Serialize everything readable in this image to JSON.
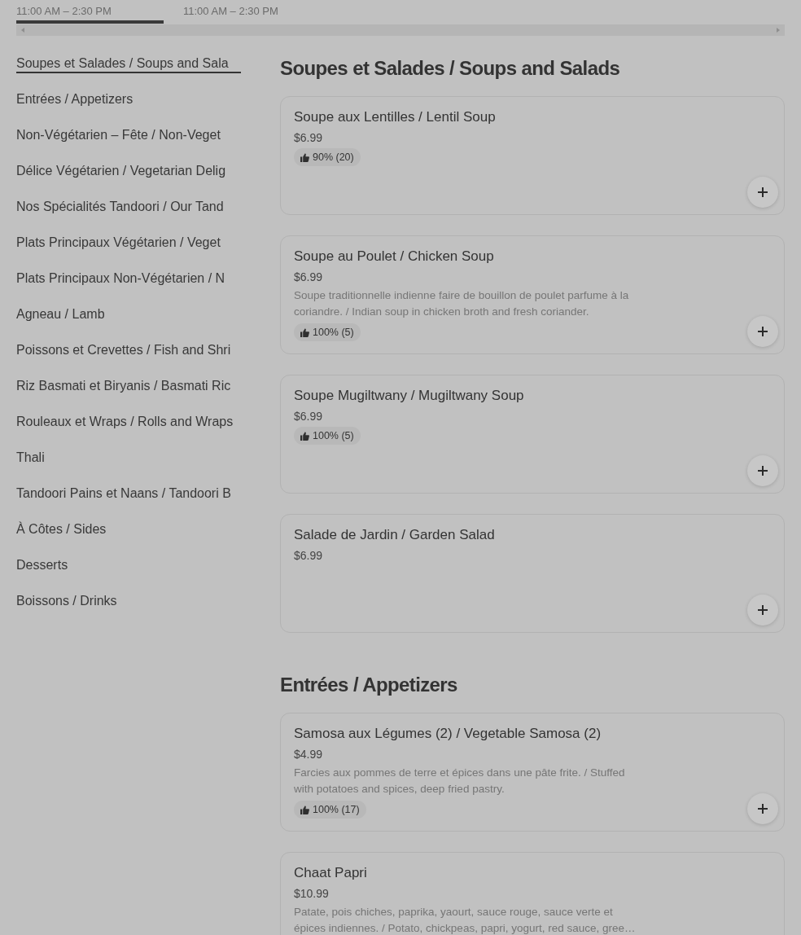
{
  "menu_tabs": [
    {
      "label": "11:00 AM – 2:30 PM",
      "selected": true
    },
    {
      "label": "11:00 AM – 2:30 PM",
      "selected": false
    }
  ],
  "categories": [
    {
      "label": "Soupes et Salades / Soups and Sala",
      "selected": true
    },
    {
      "label": "Entrées / Appetizers",
      "selected": false
    },
    {
      "label": "Non-Végétarien – Fête / Non-Veget",
      "selected": false
    },
    {
      "label": "Délice Végétarien / Vegetarian Delig",
      "selected": false
    },
    {
      "label": "Nos Spécialités Tandoori / Our Tand",
      "selected": false
    },
    {
      "label": "Plats Principaux Végétarien / Veget",
      "selected": false
    },
    {
      "label": "Plats Principaux Non-Végétarien / N",
      "selected": false
    },
    {
      "label": "Agneau / Lamb",
      "selected": false
    },
    {
      "label": "Poissons et Crevettes / Fish and Shri",
      "selected": false
    },
    {
      "label": "Riz Basmati et Biryanis / Basmati Ric",
      "selected": false
    },
    {
      "label": "Rouleaux et Wraps / Rolls and Wraps",
      "selected": false
    },
    {
      "label": "Thali",
      "selected": false
    },
    {
      "label": "Tandoori Pains et Naans / Tandoori B",
      "selected": false
    },
    {
      "label": "À Côtes / Sides",
      "selected": false
    },
    {
      "label": "Desserts",
      "selected": false
    },
    {
      "label": "Boissons / Drinks",
      "selected": false
    }
  ],
  "sections": [
    {
      "title": "Soupes et Salades / Soups and Salads",
      "items": [
        {
          "name": "Soupe aux Lentilles / Lentil Soup",
          "price": "$6.99",
          "rating": "90% (20)",
          "add_button": true
        },
        {
          "name": "Soupe au Poulet / Chicken Soup",
          "price": "$6.99",
          "description": "Soupe traditionnelle indienne faire de bouillon de poulet parfume à la coriandre. / Indian soup in chicken broth and fresh coriander.",
          "rating": "100% (5)",
          "add_button": true
        },
        {
          "name": "Soupe Mugiltwany / Mugiltwany Soup",
          "price": "$6.99",
          "rating": "100% (5)",
          "add_button": true
        },
        {
          "name": "Salade de Jardin / Garden Salad",
          "price": "$6.99",
          "add_button": true
        }
      ]
    },
    {
      "title": "Entrées / Appetizers",
      "items": [
        {
          "name": "Samosa aux Légumes (2) / Vegetable Samosa (2)",
          "price": "$4.99",
          "description": "Farcies aux pommes de terre et épices dans une pâte frite. / Stuffed with potatoes and spices, deep fried pastry.",
          "rating": "100% (17)",
          "add_button": true
        },
        {
          "name": "Chaat Papri",
          "price": "$10.99",
          "description": "Patate, pois chiches, paprika, yaourt, sauce rouge, sauce verte et épices indiennes. / Potato, chickpeas, papri, yogurt, red sauce, gree…"
        }
      ]
    }
  ]
}
